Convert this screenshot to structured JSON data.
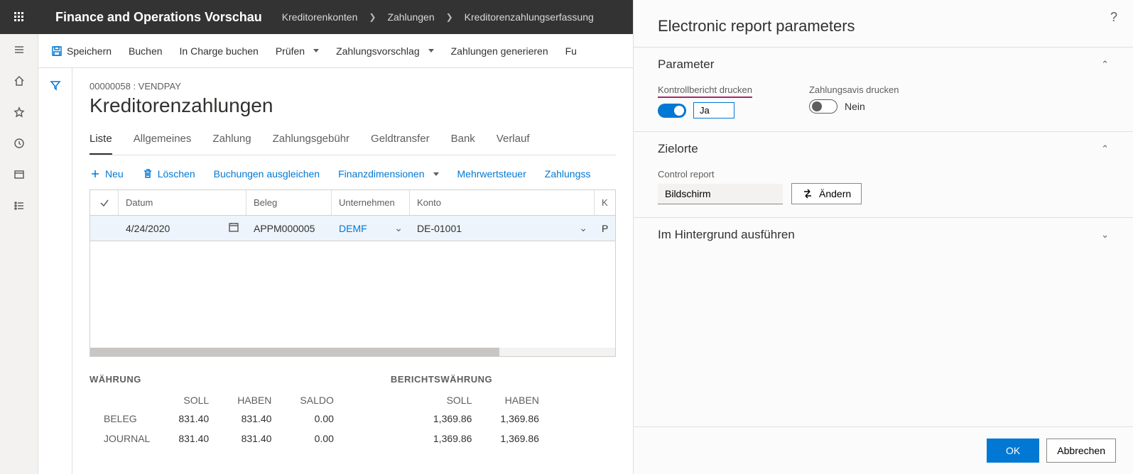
{
  "brand": "Finance and Operations Vorschau",
  "breadcrumb": [
    "Kreditorenkonten",
    "Zahlungen",
    "Kreditorenzahlungserfassung"
  ],
  "cmdbar": {
    "save": "Speichern",
    "post": "Buchen",
    "post_charge": "In Charge buchen",
    "validate": "Prüfen",
    "proposal": "Zahlungsvorschlag",
    "generate": "Zahlungen generieren",
    "fu": "Fu"
  },
  "page": {
    "eyebrow": "00000058 : VENDPAY",
    "title": "Kreditorenzahlungen"
  },
  "tabs": [
    "Liste",
    "Allgemeines",
    "Zahlung",
    "Zahlungsgebühr",
    "Geldtransfer",
    "Bank",
    "Verlauf"
  ],
  "subtoolbar": {
    "new": "Neu",
    "delete": "Löschen",
    "settle": "Buchungen ausgleichen",
    "findim": "Finanzdimensionen",
    "vat": "Mehrwertsteuer",
    "paystatus": "Zahlungss"
  },
  "grid": {
    "headers": {
      "date": "Datum",
      "voucher": "Beleg",
      "company": "Unternehmen",
      "account": "Konto",
      "k": "K"
    },
    "row": {
      "date": "4/24/2020",
      "voucher": "APPM000005",
      "company": "DEMF",
      "account": "DE-01001",
      "k": "P"
    }
  },
  "totals": {
    "currency_title": "WÄHRUNG",
    "reporting_title": "BERICHTSWÄHRUNG",
    "cols": {
      "debit": "SOLL",
      "credit": "HABEN",
      "balance": "SALDO"
    },
    "rows": [
      {
        "label": "BELEG",
        "debit": "831.40",
        "credit": "831.40",
        "balance": "0.00",
        "r_debit": "1,369.86",
        "r_credit": "1,369.86"
      },
      {
        "label": "JOURNAL",
        "debit": "831.40",
        "credit": "831.40",
        "balance": "0.00",
        "r_debit": "1,369.86",
        "r_credit": "1,369.86"
      }
    ]
  },
  "panel": {
    "title": "Electronic report parameters",
    "sections": {
      "parameter": {
        "title": "Parameter",
        "print_control": {
          "label": "Kontrollbericht drucken",
          "value_text": "Ja",
          "on": true
        },
        "print_advice": {
          "label": "Zahlungsavis drucken",
          "value_text": "Nein",
          "on": false
        }
      },
      "destinations": {
        "title": "Zielorte",
        "control_report_label": "Control report",
        "control_report_value": "Bildschirm",
        "change_btn": "Ändern"
      },
      "background": {
        "title": "Im Hintergrund ausführen"
      }
    },
    "footer": {
      "ok": "OK",
      "cancel": "Abbrechen"
    }
  }
}
